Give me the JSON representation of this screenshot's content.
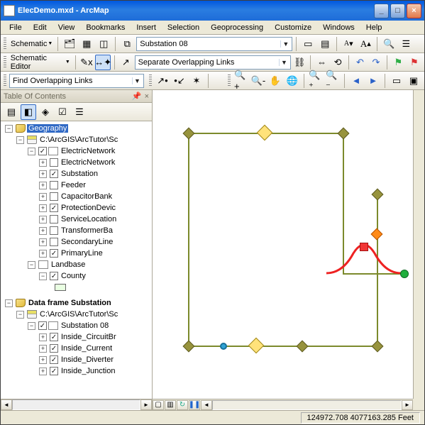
{
  "window": {
    "title": "ElecDemo.mxd - ArcMap"
  },
  "menu": {
    "file": "File",
    "edit": "Edit",
    "view": "View",
    "bookmarks": "Bookmarks",
    "insert": "Insert",
    "selection": "Selection",
    "geoprocessing": "Geoprocessing",
    "customize": "Customize",
    "windows": "Windows",
    "help": "Help"
  },
  "tb1": {
    "schematic": "Schematic",
    "target": "Substation 08",
    "fontA": "A"
  },
  "tb2": {
    "editor": "Schematic Editor",
    "task": "Separate Overlapping Links"
  },
  "tb3": {
    "find": "Find Overlapping Links"
  },
  "toc": {
    "title": "Table Of Contents",
    "df1": {
      "name": "Geography",
      "gdb": "C:\\ArcGIS\\ArcTutor\\Sc",
      "grp": "ElectricNetwork",
      "layers": [
        "ElectricNetwork",
        "Substation",
        "Feeder",
        "CapacitorBank",
        "ProtectionDevic",
        "ServiceLocation",
        "TransformerBa",
        "SecondaryLine",
        "PrimaryLine"
      ],
      "landbase": "Landbase",
      "county": "County"
    },
    "df2": {
      "name": "Data frame Substation",
      "gdb": "C:\\ArcGIS\\ArcTutor\\Sc",
      "grp": "Substation 08",
      "layers": [
        "Inside_CircuitBr",
        "Inside_Current",
        "Inside_Diverter",
        "Inside_Junction"
      ]
    }
  },
  "status": {
    "coords": "124972.708 4077163.285 Feet"
  }
}
